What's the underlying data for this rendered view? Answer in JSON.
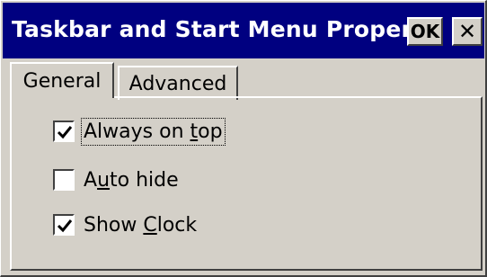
{
  "window": {
    "title": "Taskbar and Start Menu Proper...",
    "ok_label": "OK",
    "close_label": "✕"
  },
  "tabs": [
    {
      "label": "General",
      "selected": true
    },
    {
      "label": "Advanced",
      "selected": false
    }
  ],
  "options": [
    {
      "before": "Always on ",
      "mnemonic": "t",
      "after": "op",
      "checked": true
    },
    {
      "before": "A",
      "mnemonic": "u",
      "after": "to hide",
      "checked": false
    },
    {
      "before": "Show ",
      "mnemonic": "C",
      "after": "lock",
      "checked": true
    }
  ],
  "colors": {
    "titlebar": "#000080",
    "face": "#d4d0c8"
  }
}
